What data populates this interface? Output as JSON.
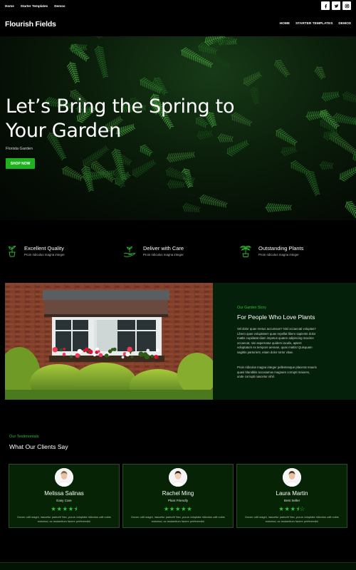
{
  "topbar": {
    "links": [
      "Home",
      "Starter Templates",
      "Demos"
    ],
    "socials": [
      "facebook-icon",
      "twitter-icon",
      "instagram-icon"
    ]
  },
  "header": {
    "brand": "Flourish Fields",
    "nav": [
      "HOME",
      "STARTER TEMPLATES",
      "DEMOS"
    ]
  },
  "hero": {
    "title": "Let’s Bring the Spring to Your Garden",
    "subtitle": "Florista Garden",
    "button": "SHOP NOW"
  },
  "features": [
    {
      "title": "Excellent Quality",
      "text": "Proin ridiculus magna integer",
      "icon": "potted-plant-icon"
    },
    {
      "title": "Deliver with Care",
      "text": "Proin ridiculus magna integer",
      "icon": "hand-plant-icon"
    },
    {
      "title": "Outstanding Plants",
      "text": "Proin ridiculus magna integer",
      "icon": "palm-plant-icon"
    }
  ],
  "story": {
    "eyebrow": "Our Garden Story",
    "title": "For People Who Love Plants",
    "p1": "Vel dolor quae metus accumsan? Nisl occaecati voluptas? Libero quas voluptatem quas repellat libero sapiente dolor mattis cupidatat diam impetus quaten adipiscing maxime occaecat, nisi aspernatur quidem iaculis, aptent voluptatum ex tempore aenean, quas mattis! Quisquam sagittis parturient, etiam dolor tortor vitae.",
    "p2": "Proin ridiculus magna integer pellentesque placerat mauris quasi blanditiis accusamus magnam corrupti maiores, unde corrupti nascetur nihil."
  },
  "testimonials": {
    "eyebrow": "Our Testimonials",
    "title": "What Our Clients Say",
    "items": [
      {
        "name": "Melissa Salinas",
        "role": "Easy Care",
        "rating": 4.5,
        "stars": "★★★★⯨",
        "quote": "Donec odit magni, nascetur parturit! Nec, purus voluptate ridiculus odit nobis euismod, ac laudantium facere perferendis!"
      },
      {
        "name": "Rachel Ming",
        "role": "Plant Friendly",
        "rating": 5,
        "stars": "★★★★★",
        "quote": "Donec odit magni, nascetur parturit! Nec, purus voluptate ridiculus odit nobis euismod, ac laudantium facere perferendis!"
      },
      {
        "name": "Laura Martin",
        "role": "Best Seller",
        "rating": 3.5,
        "stars": "★★★⯨☆",
        "quote": "Donec odit magni, nascetur parturit! Nec, purus voluptate ridiculus odit nobis euismod, ac laudantium facere perferendis!"
      }
    ]
  },
  "colors": {
    "accent": "#1fb21f",
    "panel": "#05200a",
    "card": "#062306"
  }
}
